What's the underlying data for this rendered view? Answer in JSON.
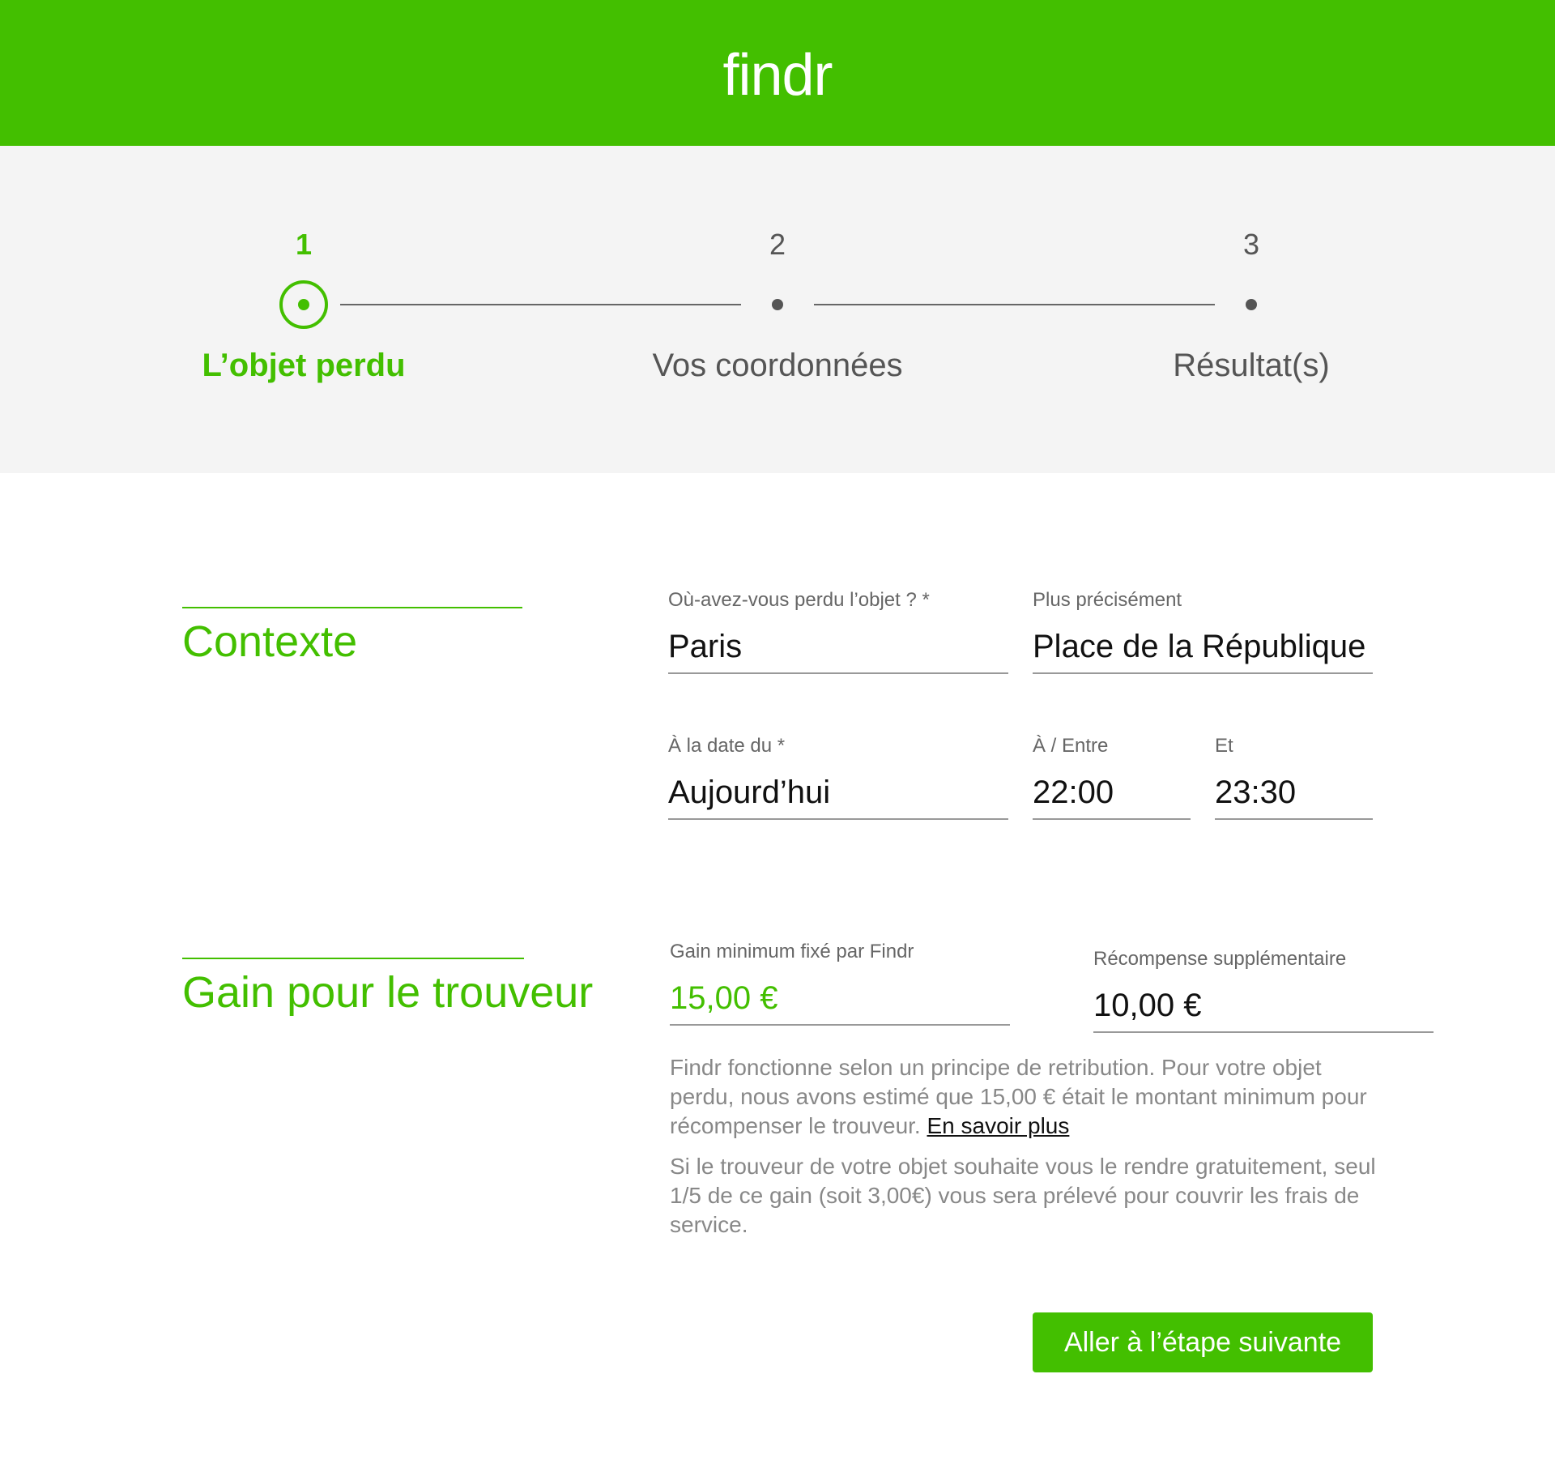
{
  "header": {
    "logo": "findr"
  },
  "stepper": {
    "steps": [
      {
        "number": "1",
        "label": "L’objet perdu",
        "active": true
      },
      {
        "number": "2",
        "label": "Vos coordonnées",
        "active": false
      },
      {
        "number": "3",
        "label": "Résultat(s)",
        "active": false
      }
    ]
  },
  "context": {
    "title": "Contexte",
    "location": {
      "label": "Où-avez-vous perdu l’objet ? *",
      "value": "Paris"
    },
    "precise": {
      "label": "Plus précisément",
      "value": "Place de la République"
    },
    "date": {
      "label": "À la date du *",
      "value": "Aujourd’hui"
    },
    "time_from": {
      "label": "À / Entre",
      "value": "22:00"
    },
    "time_to": {
      "label": "Et",
      "value": "23:30"
    }
  },
  "reward": {
    "title": "Gain pour le trouveur",
    "minimum": {
      "label": "Gain minimum fixé par Findr",
      "value": "15,00 €"
    },
    "extra": {
      "label": "Récompense supplémentaire",
      "value": "10,00 €"
    },
    "info1_text": "Findr fonctionne selon un principe de retribution. Pour votre objet perdu, nous avons estimé que 15,00 € était le montant minimum pour récompenser le trouveur. ",
    "info1_link": "En savoir plus",
    "info2_text": "Si le trouveur de votre objet souhaite vous le rendre gratuitement, seul 1/5 de ce gain (soit 3,00€) vous sera prélevé pour couvrir les frais de service."
  },
  "cta": {
    "label": "Aller à l’étape suivante"
  },
  "colors": {
    "brand": "#43bf00",
    "stepper_bg": "#f4f4f4",
    "muted_text": "#888888"
  }
}
